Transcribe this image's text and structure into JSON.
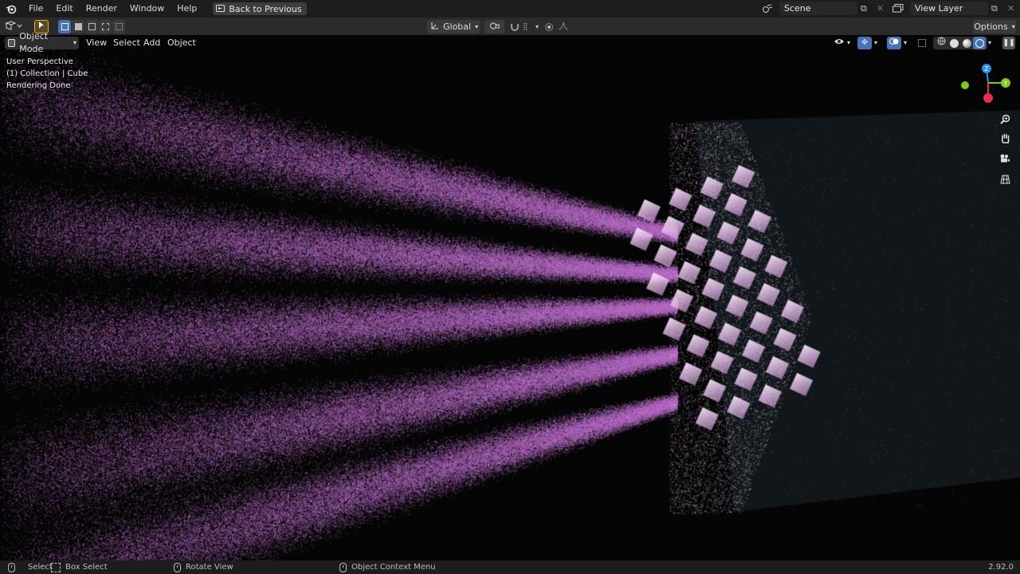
{
  "menubar": {
    "items": [
      "File",
      "Edit",
      "Render",
      "Window",
      "Help"
    ],
    "back_label": "Back to Previous",
    "scene_value": "Scene",
    "view_layer_value": "View Layer"
  },
  "toolbar": {
    "transform_orientation": "Global",
    "options_label": "Options"
  },
  "viewport_header": {
    "mode": "Object Mode",
    "menus": [
      "View",
      "Select",
      "Add",
      "Object"
    ]
  },
  "viewport": {
    "perspective": "User Perspective",
    "collection": "(1) Collection | Cube",
    "status": "Rendering Done"
  },
  "gizmo": {
    "z": "Z",
    "y": "Y"
  },
  "statusbar": {
    "select": "Select",
    "box_select": "Box Select",
    "rotate": "Rotate View",
    "context_menu": "Object Context Menu",
    "version": "2.92.0"
  },
  "colors": {
    "accent": "#4772b3",
    "particles": "#b070b8",
    "gizmo_x": "#e2314b",
    "gizmo_y": "#82c81e",
    "gizmo_z": "#2e8de6"
  }
}
